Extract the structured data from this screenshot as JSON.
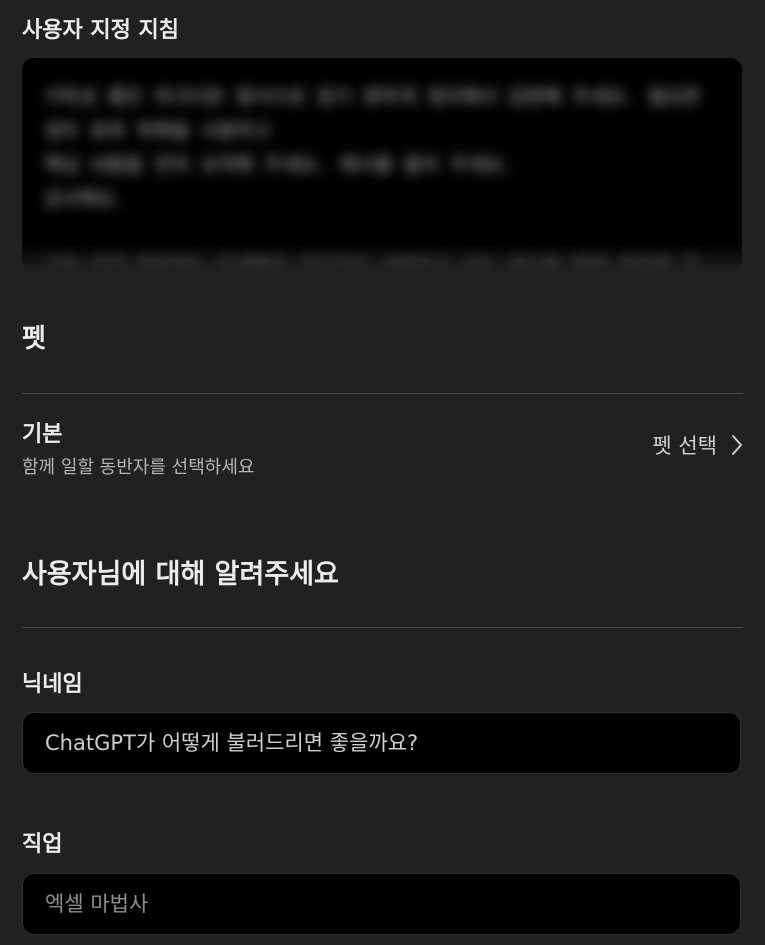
{
  "custom_instructions": {
    "label": "사용자 지정 지침",
    "text": "가독성 좋은 마크다운 형식으로 읽기 편하게 정리해서 답변해 주세요. 필요한 경우 표와 목록을 사용하고\n핵심 내용을 먼저 요약해 주세요. 예시를 들어 주세요.\n감사해요.\n\n기술 관련 질문에는 단계별로 차근차근 설명하고 코드 예시를 함께 제공해 주세요.\n또 가능하면 최신 정보를 기준으로 알려 주세요."
  },
  "pet": {
    "heading": "펫",
    "row_title": "기본",
    "row_subtitle": "함께 일할 동반자를 선택하세요",
    "select_label": "펫 선택"
  },
  "about_you": {
    "heading": "사용자님에 대해 알려주세요",
    "nickname_label": "닉네임",
    "nickname_placeholder": "ChatGPT가 어떻게 불러드리면 좋을까요?",
    "job_label": "직업",
    "job_placeholder": "엑셀 마법사"
  }
}
